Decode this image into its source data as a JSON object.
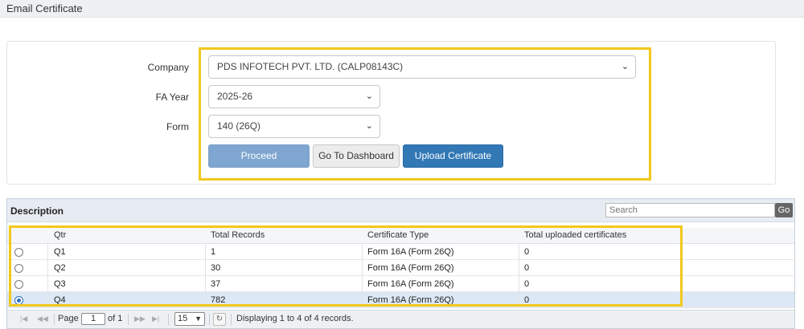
{
  "page": {
    "title": "Email Certificate"
  },
  "form": {
    "company_label": "Company",
    "company_value": "PDS INFOTECH PVT. LTD. (CALP08143C)",
    "fa_year_label": "FA Year",
    "fa_year_value": "2025-26",
    "form_label": "Form",
    "form_value": "140 (26Q)",
    "proceed_label": "Proceed",
    "dashboard_label": "Go To Dashboard",
    "upload_label": "Upload Certificate"
  },
  "grid": {
    "title": "Description",
    "search_placeholder": "Search",
    "go_label": "Go",
    "columns": [
      "Qtr",
      "Total Records",
      "Certificate Type",
      "Total uploaded certificates"
    ],
    "rows": [
      {
        "qtr": "Q1",
        "total_records": "1",
        "certificate_type": "Form 16A (Form 26Q)",
        "uploaded": "0",
        "selected": false
      },
      {
        "qtr": "Q2",
        "total_records": "30",
        "certificate_type": "Form 16A (Form 26Q)",
        "uploaded": "0",
        "selected": false
      },
      {
        "qtr": "Q3",
        "total_records": "37",
        "certificate_type": "Form 16A (Form 26Q)",
        "uploaded": "0",
        "selected": false
      },
      {
        "qtr": "Q4",
        "total_records": "782",
        "certificate_type": "Form 16A (Form 26Q)",
        "uploaded": "0",
        "selected": true
      }
    ],
    "pager": {
      "page_label": "Page",
      "page_value": "1",
      "of_label": "of 1",
      "page_size": "15",
      "status": "Displaying 1 to 4 of 4 records."
    }
  },
  "icons": {
    "dropdown": "chevron-down-icon",
    "first": "first-page-icon",
    "prev": "prev-page-icon",
    "next": "next-page-icon",
    "last": "last-page-icon",
    "refresh": "refresh-icon"
  },
  "colors": {
    "highlight": "#f2c81c",
    "primary_button": "#3278b5",
    "proceed_button": "#7fa6d0",
    "selected_row": "#dce8f5"
  }
}
